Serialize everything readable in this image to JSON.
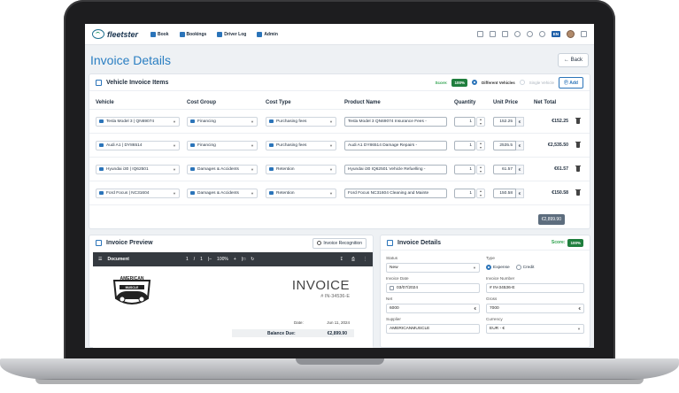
{
  "app": {
    "logo": "fleetster"
  },
  "nav": {
    "items": [
      "Book",
      "Bookings",
      "Driver Log",
      "Admin"
    ],
    "lang": "EN"
  },
  "page": {
    "title": "Invoice Details",
    "back_label": "Back"
  },
  "items": {
    "title": "Vehicle Invoice Items",
    "score_label": "Score:",
    "score_value": "100%",
    "radio_different": "Different Vehicles",
    "radio_single": "Single Vehicle",
    "add_label": "Add",
    "columns": [
      "Vehicle",
      "Cost Group",
      "Cost Type",
      "Product Name",
      "Quantity",
      "Unit Price",
      "Net Total"
    ],
    "rows": [
      {
        "vehicle": "Tesla Model 3 | QN69074",
        "cost_group": "Financing",
        "cost_type": "Purchasing fees",
        "product": "Tesla Model 3 QN69074 Insurance Fees -",
        "qty": "1",
        "unit_price": "152.25",
        "currency": "€",
        "net": "€152.25"
      },
      {
        "vehicle": "Audi A1 | DY86514",
        "cost_group": "Financing",
        "cost_type": "Purchasing fees",
        "product": "Audi A1 DY86514 Damage Repairs -",
        "qty": "1",
        "unit_price": "2535.5",
        "currency": "€",
        "net": "€2,535.50"
      },
      {
        "vehicle": "Hyundai i30 | IQ62501",
        "cost_group": "Damages & Accidents",
        "cost_type": "Retention",
        "product": "Hyundai i30 IQ62501 Vehicle Refuelling -",
        "qty": "1",
        "unit_price": "61.57",
        "currency": "€",
        "net": "€61.57"
      },
      {
        "vehicle": "Ford Focus | NC31604",
        "cost_group": "Damages & Accidents",
        "cost_type": "Retention",
        "product": "Ford Focus NC31604 Cleaning and Mainte",
        "qty": "1",
        "unit_price": "150.58",
        "currency": "€",
        "net": "€150.58"
      }
    ],
    "total": "€2,899.90"
  },
  "preview": {
    "title": "Invoice Preview",
    "recognition_label": "Invoice Recognition",
    "pdf": {
      "doc_label": "Document",
      "page": "1",
      "page_sep": "/",
      "pages": "1",
      "zoom": "100%"
    },
    "invoice": {
      "logo_top": "AMERICAN",
      "logo_banner": "MUSCLE",
      "heading": "INVOICE",
      "number": "# IN-34536-E",
      "date_label": "Date:",
      "date_value": "Jun 11, 2024",
      "balance_label": "Balance Due:",
      "balance_value": "€2,899.90"
    }
  },
  "details": {
    "title": "Invoice Details",
    "score_label": "Score:",
    "score_value": "100%",
    "status_label": "Status",
    "status_value": "New",
    "type_label": "Type",
    "type_expense": "Expense",
    "type_credit": "Credit",
    "date_label": "Invoice Date",
    "date_value": "03/07/2024",
    "number_label": "Invoice Number",
    "number_value": "# IN-34536-E",
    "net_label": "Net",
    "net_value": "6000",
    "net_currency": "€",
    "gross_label": "Gross",
    "gross_value": "7000",
    "gross_currency": "€",
    "supplier_label": "Supplier",
    "supplier_value": "AMERICANMUSCLE",
    "currency_label": "Currency",
    "currency_value": "EUR - €"
  },
  "colors": {
    "accent": "#2b74b9",
    "score_green": "#1f7e3d",
    "title_blue": "#2a7ec2"
  }
}
